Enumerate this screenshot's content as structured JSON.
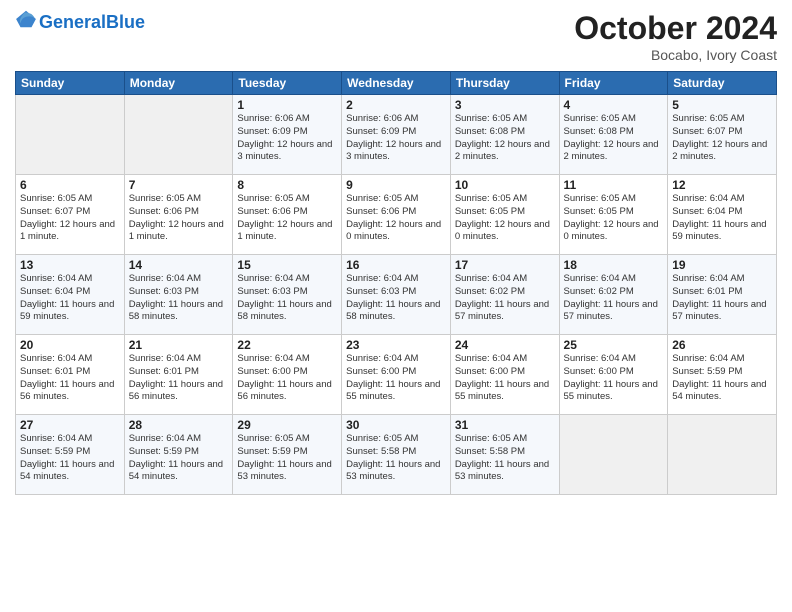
{
  "header": {
    "logo_general": "General",
    "logo_blue": "Blue",
    "month_year": "October 2024",
    "location": "Bocabo, Ivory Coast"
  },
  "weekdays": [
    "Sunday",
    "Monday",
    "Tuesday",
    "Wednesday",
    "Thursday",
    "Friday",
    "Saturday"
  ],
  "weeks": [
    [
      {
        "day": "",
        "info": ""
      },
      {
        "day": "",
        "info": ""
      },
      {
        "day": "1",
        "info": "Sunrise: 6:06 AM\nSunset: 6:09 PM\nDaylight: 12 hours\nand 3 minutes."
      },
      {
        "day": "2",
        "info": "Sunrise: 6:06 AM\nSunset: 6:09 PM\nDaylight: 12 hours\nand 3 minutes."
      },
      {
        "day": "3",
        "info": "Sunrise: 6:05 AM\nSunset: 6:08 PM\nDaylight: 12 hours\nand 2 minutes."
      },
      {
        "day": "4",
        "info": "Sunrise: 6:05 AM\nSunset: 6:08 PM\nDaylight: 12 hours\nand 2 minutes."
      },
      {
        "day": "5",
        "info": "Sunrise: 6:05 AM\nSunset: 6:07 PM\nDaylight: 12 hours\nand 2 minutes."
      }
    ],
    [
      {
        "day": "6",
        "info": "Sunrise: 6:05 AM\nSunset: 6:07 PM\nDaylight: 12 hours\nand 1 minute."
      },
      {
        "day": "7",
        "info": "Sunrise: 6:05 AM\nSunset: 6:06 PM\nDaylight: 12 hours\nand 1 minute."
      },
      {
        "day": "8",
        "info": "Sunrise: 6:05 AM\nSunset: 6:06 PM\nDaylight: 12 hours\nand 1 minute."
      },
      {
        "day": "9",
        "info": "Sunrise: 6:05 AM\nSunset: 6:06 PM\nDaylight: 12 hours\nand 0 minutes."
      },
      {
        "day": "10",
        "info": "Sunrise: 6:05 AM\nSunset: 6:05 PM\nDaylight: 12 hours\nand 0 minutes."
      },
      {
        "day": "11",
        "info": "Sunrise: 6:05 AM\nSunset: 6:05 PM\nDaylight: 12 hours\nand 0 minutes."
      },
      {
        "day": "12",
        "info": "Sunrise: 6:04 AM\nSunset: 6:04 PM\nDaylight: 11 hours\nand 59 minutes."
      }
    ],
    [
      {
        "day": "13",
        "info": "Sunrise: 6:04 AM\nSunset: 6:04 PM\nDaylight: 11 hours\nand 59 minutes."
      },
      {
        "day": "14",
        "info": "Sunrise: 6:04 AM\nSunset: 6:03 PM\nDaylight: 11 hours\nand 58 minutes."
      },
      {
        "day": "15",
        "info": "Sunrise: 6:04 AM\nSunset: 6:03 PM\nDaylight: 11 hours\nand 58 minutes."
      },
      {
        "day": "16",
        "info": "Sunrise: 6:04 AM\nSunset: 6:03 PM\nDaylight: 11 hours\nand 58 minutes."
      },
      {
        "day": "17",
        "info": "Sunrise: 6:04 AM\nSunset: 6:02 PM\nDaylight: 11 hours\nand 57 minutes."
      },
      {
        "day": "18",
        "info": "Sunrise: 6:04 AM\nSunset: 6:02 PM\nDaylight: 11 hours\nand 57 minutes."
      },
      {
        "day": "19",
        "info": "Sunrise: 6:04 AM\nSunset: 6:01 PM\nDaylight: 11 hours\nand 57 minutes."
      }
    ],
    [
      {
        "day": "20",
        "info": "Sunrise: 6:04 AM\nSunset: 6:01 PM\nDaylight: 11 hours\nand 56 minutes."
      },
      {
        "day": "21",
        "info": "Sunrise: 6:04 AM\nSunset: 6:01 PM\nDaylight: 11 hours\nand 56 minutes."
      },
      {
        "day": "22",
        "info": "Sunrise: 6:04 AM\nSunset: 6:00 PM\nDaylight: 11 hours\nand 56 minutes."
      },
      {
        "day": "23",
        "info": "Sunrise: 6:04 AM\nSunset: 6:00 PM\nDaylight: 11 hours\nand 55 minutes."
      },
      {
        "day": "24",
        "info": "Sunrise: 6:04 AM\nSunset: 6:00 PM\nDaylight: 11 hours\nand 55 minutes."
      },
      {
        "day": "25",
        "info": "Sunrise: 6:04 AM\nSunset: 6:00 PM\nDaylight: 11 hours\nand 55 minutes."
      },
      {
        "day": "26",
        "info": "Sunrise: 6:04 AM\nSunset: 5:59 PM\nDaylight: 11 hours\nand 54 minutes."
      }
    ],
    [
      {
        "day": "27",
        "info": "Sunrise: 6:04 AM\nSunset: 5:59 PM\nDaylight: 11 hours\nand 54 minutes."
      },
      {
        "day": "28",
        "info": "Sunrise: 6:04 AM\nSunset: 5:59 PM\nDaylight: 11 hours\nand 54 minutes."
      },
      {
        "day": "29",
        "info": "Sunrise: 6:05 AM\nSunset: 5:59 PM\nDaylight: 11 hours\nand 53 minutes."
      },
      {
        "day": "30",
        "info": "Sunrise: 6:05 AM\nSunset: 5:58 PM\nDaylight: 11 hours\nand 53 minutes."
      },
      {
        "day": "31",
        "info": "Sunrise: 6:05 AM\nSunset: 5:58 PM\nDaylight: 11 hours\nand 53 minutes."
      },
      {
        "day": "",
        "info": ""
      },
      {
        "day": "",
        "info": ""
      }
    ]
  ]
}
